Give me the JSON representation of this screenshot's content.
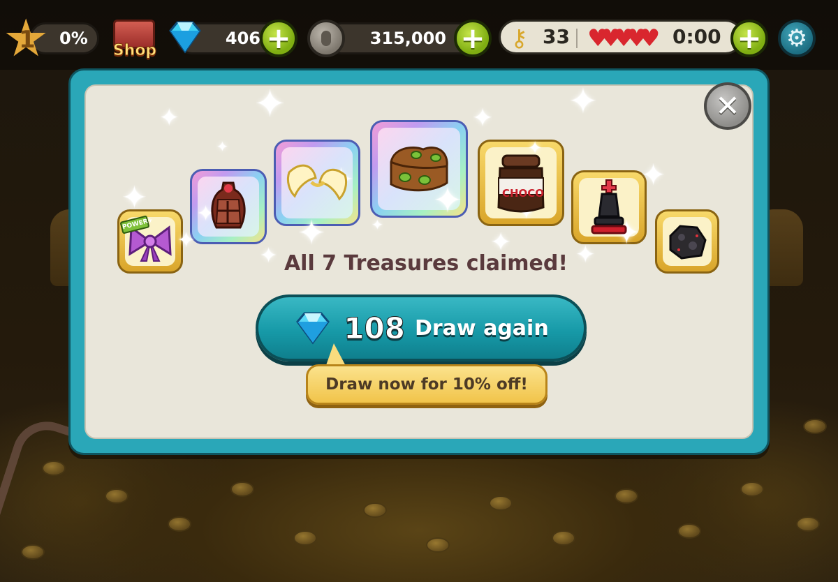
{
  "topbar": {
    "level": "1",
    "level_progress": "0%",
    "shop_label": "Shop",
    "gems": "406",
    "coins": "315,000",
    "keys": "33",
    "lives_filled": 5,
    "lives_timer": "0:00"
  },
  "modal": {
    "title": "All 7 Treasures claimed!",
    "draw_cost": "108",
    "draw_label": "Draw again",
    "promo": "Draw now for 10% off!",
    "choco_label": "CHOCO",
    "power_tag": "POWER+"
  },
  "treasures": [
    {
      "name": "bow",
      "rarity": "epic"
    },
    {
      "name": "vase",
      "rarity": "legendary"
    },
    {
      "name": "wings",
      "rarity": "legendary"
    },
    {
      "name": "kiwi-bread",
      "rarity": "legendary"
    },
    {
      "name": "choco-jar",
      "rarity": "epic"
    },
    {
      "name": "chess-king",
      "rarity": "epic"
    },
    {
      "name": "meteor",
      "rarity": "epic"
    }
  ],
  "colors": {
    "modal_border": "#2aa7b8",
    "draw_button": "#179aa8",
    "promo_bubble": "#f1c44a",
    "plus_button": "#7fae12",
    "heart": "#d9262e"
  }
}
